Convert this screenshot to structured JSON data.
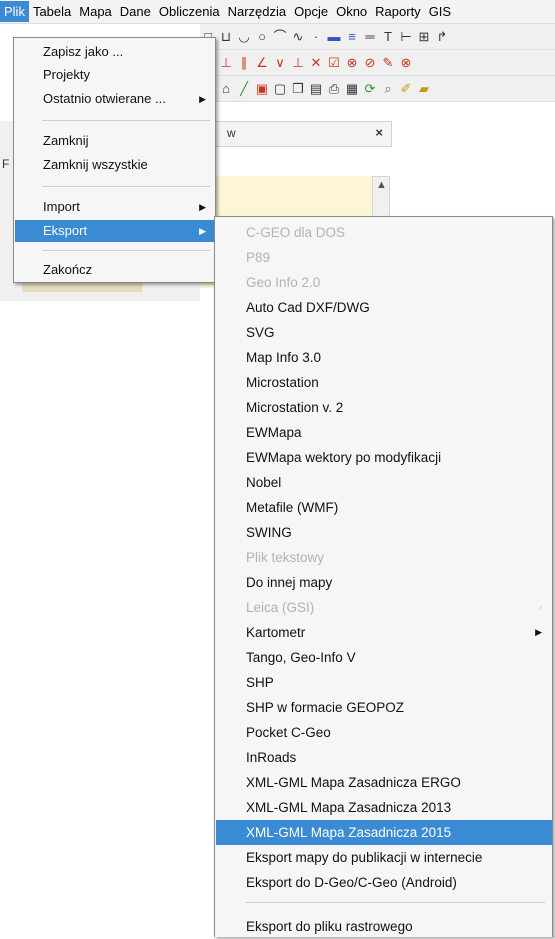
{
  "menubar": {
    "items": [
      "Plik",
      "Tabela",
      "Mapa",
      "Dane",
      "Obliczenia",
      "Narzędzia",
      "Opcje",
      "Okno",
      "Raporty",
      "GIS"
    ],
    "active_index": 0
  },
  "panel": {
    "title_fragment": "w",
    "close_label": "×",
    "left_fragment": "F"
  },
  "file_menu": {
    "items": [
      {
        "label": "Zapisz jako ..."
      },
      {
        "label": "Projekty"
      },
      {
        "label": "Ostatnio otwierane ...",
        "submenu": true
      },
      {
        "label": "Zamknij"
      },
      {
        "label": "Zamknij wszystkie"
      },
      {
        "label": "Import",
        "submenu": true
      },
      {
        "label": "Eksport",
        "submenu": true,
        "selected": true
      },
      {
        "label": "Zakończ"
      }
    ]
  },
  "export_menu": {
    "items": [
      {
        "label": "C-GEO dla DOS",
        "disabled": true
      },
      {
        "label": "P89",
        "disabled": true
      },
      {
        "label": "Geo Info 2.0",
        "disabled": true
      },
      {
        "label": "Auto Cad DXF/DWG"
      },
      {
        "label": "SVG"
      },
      {
        "label": "Map Info 3.0"
      },
      {
        "label": "Microstation"
      },
      {
        "label": "Microstation v. 2"
      },
      {
        "label": "EWMapa"
      },
      {
        "label": "EWMapa wektory po modyfikacji"
      },
      {
        "label": "Nobel"
      },
      {
        "label": "Metafile (WMF)"
      },
      {
        "label": "SWING"
      },
      {
        "label": "Plik tekstowy",
        "disabled": true
      },
      {
        "label": "Do innej mapy"
      },
      {
        "label": "Leica (GSI)",
        "disabled": true,
        "submenu": true
      },
      {
        "label": "Kartometr",
        "submenu": true
      },
      {
        "label": "Tango, Geo-Info V"
      },
      {
        "label": "SHP"
      },
      {
        "label": "SHP w formacie GEOPOZ"
      },
      {
        "label": "Pocket C-Geo"
      },
      {
        "label": "InRoads"
      },
      {
        "label": "XML-GML Mapa Zasadnicza ERGO"
      },
      {
        "label": "XML-GML Mapa Zasadnicza 2013"
      },
      {
        "label": "XML-GML Mapa Zasadnicza 2015",
        "selected": true
      },
      {
        "label": "Eksport mapy do publikacji w internecie"
      },
      {
        "label": "Eksport do D-Geo/C-Geo (Android)"
      },
      {
        "label": "Eksport do pliku rastrowego"
      }
    ]
  },
  "colors": {
    "selection": "#3a8ad4",
    "menu_background": "#f6f6f6",
    "disabled_text": "#b2b2b2"
  }
}
